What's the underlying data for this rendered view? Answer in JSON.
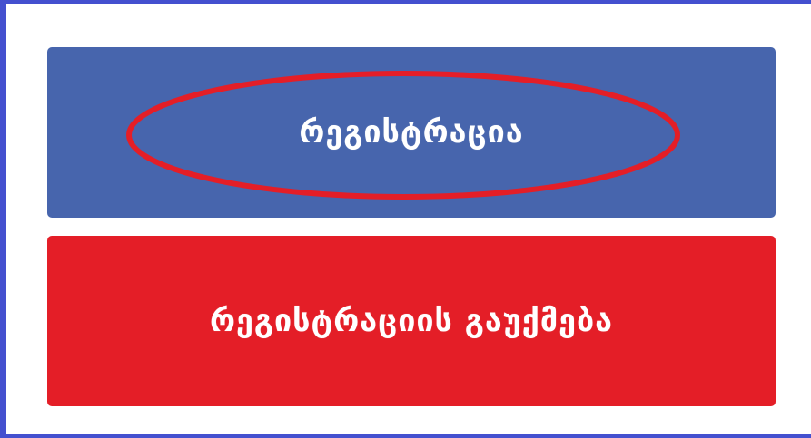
{
  "buttons": {
    "register_label": "რეგისტრაცია",
    "cancel_label": "რეგისტრაციის გაუქმება"
  },
  "colors": {
    "register_bg": "#4765ad",
    "cancel_bg": "#e41e27",
    "highlight_stroke": "#e41e27",
    "frame_border": "#4450cf"
  }
}
